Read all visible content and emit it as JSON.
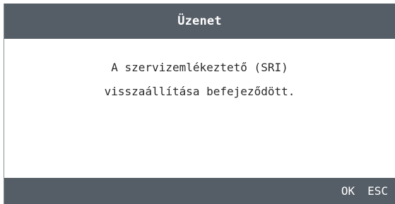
{
  "dialog": {
    "title": "Üzenet",
    "message_lines": [
      "A szervizemlékeztető (SRI)",
      "visszaállítása befejeződött."
    ],
    "softkeys": {
      "ok_label": "OK",
      "esc_label": "ESC"
    }
  },
  "colors": {
    "bar_background": "#555d66",
    "bar_text": "#ffffff",
    "body_background": "#ffffff",
    "message_text": "#2a2a2a"
  }
}
